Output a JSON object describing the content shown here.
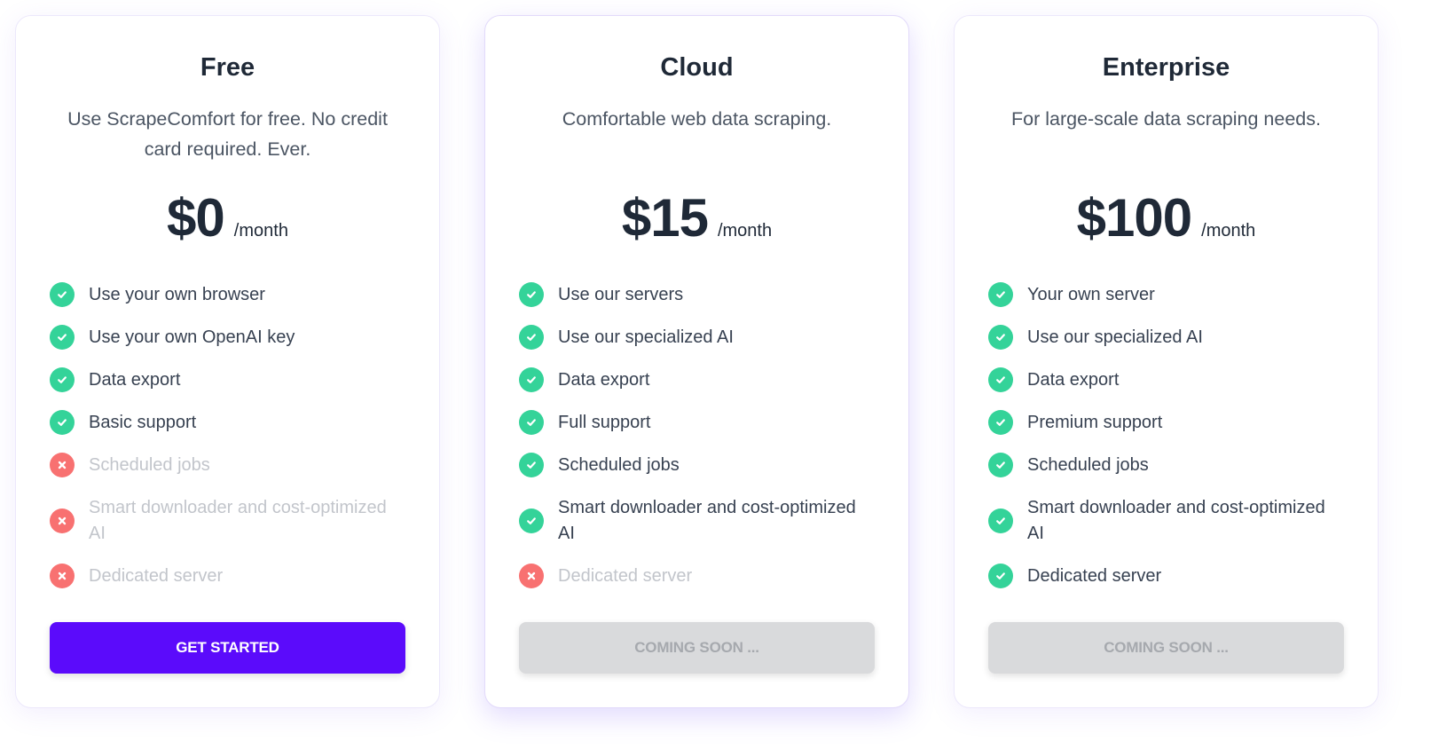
{
  "colors": {
    "accent": "#5b0bfb",
    "check": "#34d399",
    "cross": "#f87171",
    "disabled_button": "#d9dadc"
  },
  "plans": [
    {
      "name": "Free",
      "description": "Use ScrapeComfort for free. No credit card required. Ever.",
      "price": "$0",
      "period": "/month",
      "features": [
        {
          "label": "Use your own browser",
          "included": true,
          "icon": "check-circle-icon"
        },
        {
          "label": "Use your own OpenAI key",
          "included": true,
          "icon": "check-circle-icon"
        },
        {
          "label": "Data export",
          "included": true,
          "icon": "check-circle-icon"
        },
        {
          "label": "Basic support",
          "included": true,
          "icon": "check-circle-icon"
        },
        {
          "label": "Scheduled jobs",
          "included": false,
          "icon": "x-circle-icon"
        },
        {
          "label": "Smart downloader and cost-optimized AI",
          "included": false,
          "icon": "x-circle-icon"
        },
        {
          "label": "Dedicated server",
          "included": false,
          "icon": "x-circle-icon"
        }
      ],
      "button": {
        "label": "GET STARTED",
        "enabled": true
      }
    },
    {
      "name": "Cloud",
      "description": "Comfortable web data scraping.",
      "price": "$15",
      "period": "/month",
      "features": [
        {
          "label": "Use our servers",
          "included": true,
          "icon": "check-circle-icon"
        },
        {
          "label": "Use our specialized AI",
          "included": true,
          "icon": "check-circle-icon"
        },
        {
          "label": "Data export",
          "included": true,
          "icon": "check-circle-icon"
        },
        {
          "label": "Full support",
          "included": true,
          "icon": "check-circle-icon"
        },
        {
          "label": "Scheduled jobs",
          "included": true,
          "icon": "check-circle-icon"
        },
        {
          "label": "Smart downloader and cost-optimized AI",
          "included": true,
          "icon": "check-circle-icon"
        },
        {
          "label": "Dedicated server",
          "included": false,
          "icon": "x-circle-icon"
        }
      ],
      "button": {
        "label": "COMING SOON ...",
        "enabled": false
      }
    },
    {
      "name": "Enterprise",
      "description": "For large-scale data scraping needs.",
      "price": "$100",
      "period": "/month",
      "features": [
        {
          "label": "Your own server",
          "included": true,
          "icon": "check-circle-icon"
        },
        {
          "label": "Use our specialized AI",
          "included": true,
          "icon": "check-circle-icon"
        },
        {
          "label": "Data export",
          "included": true,
          "icon": "check-circle-icon"
        },
        {
          "label": "Premium support",
          "included": true,
          "icon": "check-circle-icon"
        },
        {
          "label": "Scheduled jobs",
          "included": true,
          "icon": "check-circle-icon"
        },
        {
          "label": "Smart downloader and cost-optimized AI",
          "included": true,
          "icon": "check-circle-icon"
        },
        {
          "label": "Dedicated server",
          "included": true,
          "icon": "check-circle-icon"
        }
      ],
      "button": {
        "label": "COMING SOON ...",
        "enabled": false
      }
    }
  ]
}
